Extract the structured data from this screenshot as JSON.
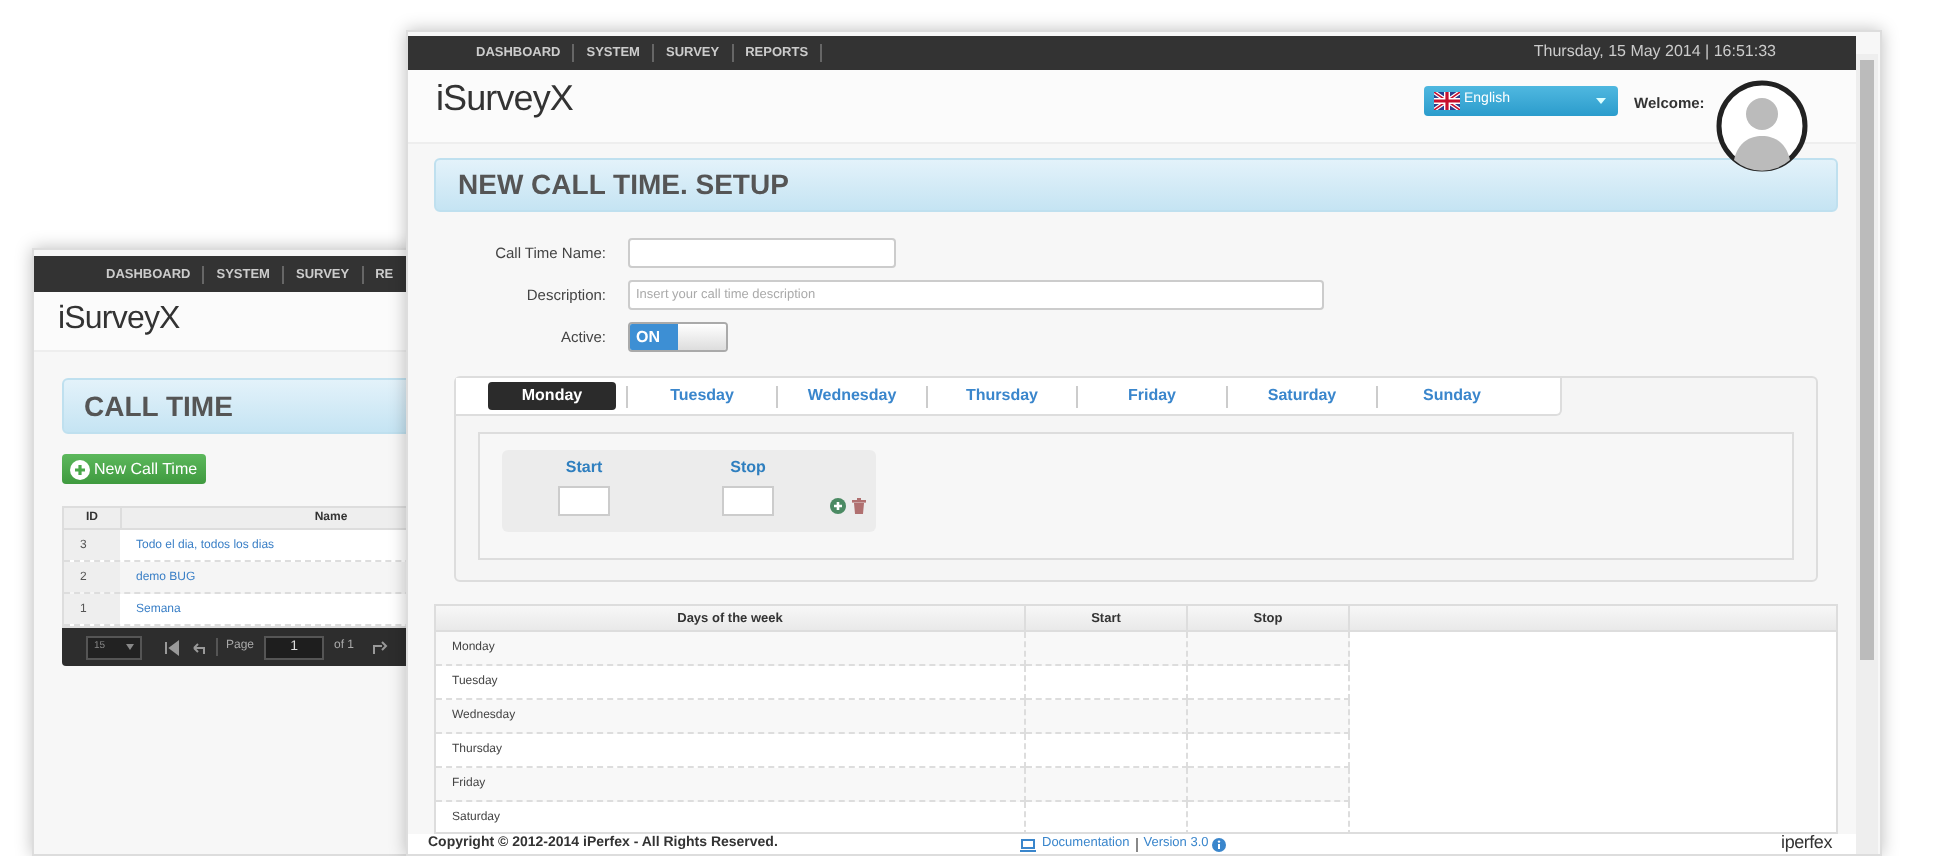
{
  "back_window": {
    "nav": [
      "DASHBOARD",
      "SYSTEM",
      "SURVEY",
      "RE"
    ],
    "logo": "iSurveyX",
    "title": "CALL TIME",
    "new_button": "New Call Time",
    "table": {
      "columns": [
        "ID",
        "Name"
      ],
      "rows": [
        {
          "id": "3",
          "name": "Todo el dia, todos los dias"
        },
        {
          "id": "2",
          "name": "demo BUG"
        },
        {
          "id": "1",
          "name": "Semana"
        }
      ]
    },
    "pager": {
      "page_size": "15",
      "page_label": "Page",
      "page": "1",
      "total": "of 1"
    }
  },
  "front_window": {
    "nav": [
      "DASHBOARD",
      "SYSTEM",
      "SURVEY",
      "REPORTS"
    ],
    "datetime": "Thursday, 15 May 2014 | 16:51:33",
    "logo": "iSurveyX",
    "language": "English",
    "welcome": "Welcome:",
    "title": "NEW CALL TIME. SETUP",
    "form": {
      "name_label": "Call Time Name:",
      "description_label": "Description:",
      "description_placeholder": "Insert your call time description",
      "active_label": "Active:",
      "active": {
        "on": true,
        "label": "ON"
      }
    },
    "tabs": [
      {
        "label": "Monday",
        "selected": true
      },
      {
        "label": "Tuesday",
        "selected": false
      },
      {
        "label": "Wednesday",
        "selected": false
      },
      {
        "label": "Thursday",
        "selected": false
      },
      {
        "label": "Friday",
        "selected": false
      },
      {
        "label": "Saturday",
        "selected": false
      },
      {
        "label": "Sunday",
        "selected": false
      }
    ],
    "time_editor": {
      "start_label": "Start",
      "stop_label": "Stop"
    },
    "table": {
      "columns": [
        "Days of the week",
        "Start",
        "Stop"
      ],
      "rows": [
        "Monday",
        "Tuesday",
        "Wednesday",
        "Thursday",
        "Friday",
        "Saturday"
      ]
    },
    "footer": {
      "copyright": "Copyright © 2012-2014 iPerfex - All Rights Reserved.",
      "documentation": "Documentation",
      "version": "Version 3.0",
      "brand": "iperfex"
    }
  }
}
